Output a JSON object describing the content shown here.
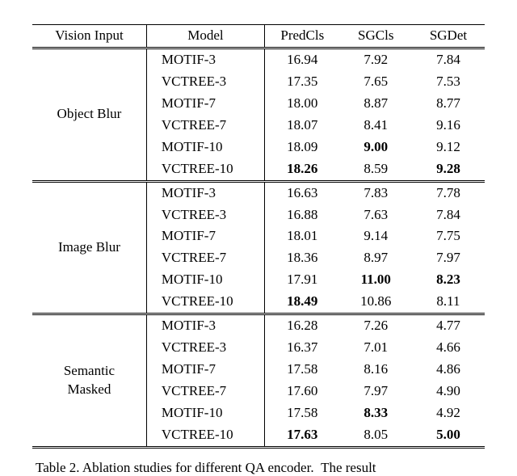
{
  "chart_data": {
    "type": "table",
    "title": "Ablation studies for different QA encoder.",
    "columns": [
      "Vision Input",
      "Model",
      "PredCls",
      "SGCls",
      "SGDet"
    ],
    "groups": [
      {
        "vision_input": "Object Blur",
        "rows": [
          {
            "model": "MOTIF-3",
            "predcls": "16.94",
            "sgcls": "7.92",
            "sgdet": "7.84"
          },
          {
            "model": "VCTREE-3",
            "predcls": "17.35",
            "sgcls": "7.65",
            "sgdet": "7.53"
          },
          {
            "model": "MOTIF-7",
            "predcls": "18.00",
            "sgcls": "8.87",
            "sgdet": "8.77"
          },
          {
            "model": "VCTREE-7",
            "predcls": "18.07",
            "sgcls": "8.41",
            "sgdet": "9.16"
          },
          {
            "model": "MOTIF-10",
            "predcls": "18.09",
            "sgcls": "9.00",
            "sgdet": "9.12"
          },
          {
            "model": "VCTREE-10",
            "predcls": "18.26",
            "sgcls": "8.59",
            "sgdet": "9.28"
          }
        ],
        "bold": {
          "predcls_row": 5,
          "sgcls_row": 4,
          "sgdet_row": 5
        }
      },
      {
        "vision_input": "Image Blur",
        "rows": [
          {
            "model": "MOTIF-3",
            "predcls": "16.63",
            "sgcls": "7.83",
            "sgdet": "7.78"
          },
          {
            "model": "VCTREE-3",
            "predcls": "16.88",
            "sgcls": "7.63",
            "sgdet": "7.84"
          },
          {
            "model": "MOTIF-7",
            "predcls": "18.01",
            "sgcls": "9.14",
            "sgdet": "7.75"
          },
          {
            "model": "VCTREE-7",
            "predcls": "18.36",
            "sgcls": "8.97",
            "sgdet": "7.97"
          },
          {
            "model": "MOTIF-10",
            "predcls": "17.91",
            "sgcls": "11.00",
            "sgdet": "8.23"
          },
          {
            "model": "VCTREE-10",
            "predcls": "18.49",
            "sgcls": "10.86",
            "sgdet": "8.11"
          }
        ],
        "bold": {
          "predcls_row": 5,
          "sgcls_row": 4,
          "sgdet_row": 4
        }
      },
      {
        "vision_input": "Semantic Masked",
        "rows": [
          {
            "model": "MOTIF-3",
            "predcls": "16.28",
            "sgcls": "7.26",
            "sgdet": "4.77"
          },
          {
            "model": "VCTREE-3",
            "predcls": "16.37",
            "sgcls": "7.01",
            "sgdet": "4.66"
          },
          {
            "model": "MOTIF-7",
            "predcls": "17.58",
            "sgcls": "8.16",
            "sgdet": "4.86"
          },
          {
            "model": "VCTREE-7",
            "predcls": "17.60",
            "sgcls": "7.97",
            "sgdet": "4.90"
          },
          {
            "model": "MOTIF-10",
            "predcls": "17.58",
            "sgcls": "8.33",
            "sgdet": "4.92"
          },
          {
            "model": "VCTREE-10",
            "predcls": "17.63",
            "sgcls": "8.05",
            "sgdet": "5.00"
          }
        ],
        "bold": {
          "predcls_row": 5,
          "sgcls_row": 4,
          "sgdet_row": 5
        }
      }
    ]
  },
  "header": {
    "vision_input": "Vision Input",
    "model": "Model",
    "predcls": "PredCls",
    "sgcls": "SGCls",
    "sgdet": "SGDet"
  },
  "caption": {
    "label": "Table 2.",
    "text_prefix": "  Ablation studies for different QA encoder",
    "text_suffix": "The result"
  }
}
